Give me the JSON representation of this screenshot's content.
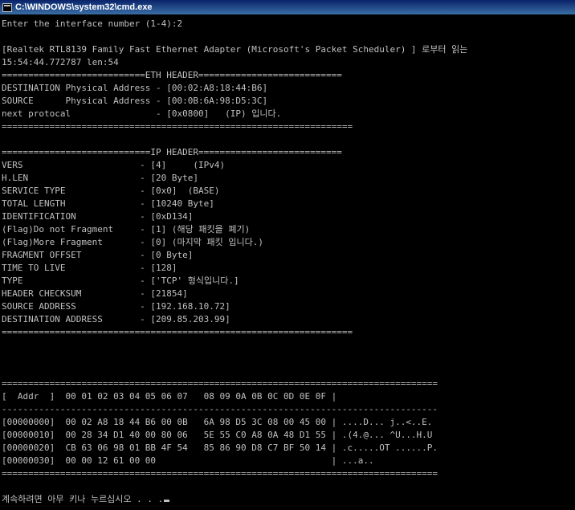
{
  "window": {
    "title": "C:\\WINDOWS\\system32\\cmd.exe"
  },
  "console": {
    "lines": [
      "Enter the interface number (1-4):2",
      "",
      "[Realtek RTL8139 Family Fast Ethernet Adapter (Microsoft's Packet Scheduler) ] 로부터 읽는",
      "15:54:44.772787 len:54",
      "===========================ETH HEADER===========================",
      "DESTINATION Physical Address - [00:02:A8:18:44:B6]",
      "SOURCE      Physical Address - [00:0B:6A:98:D5:3C]",
      "next protocal                - [0x0800]   (IP) 입니다.",
      "==================================================================",
      "",
      "============================IP HEADER===========================",
      "VERS                      - [4]     (IPv4)",
      "H.LEN                     - [20 Byte]",
      "SERVICE TYPE              - [0x0]  (BASE)",
      "TOTAL LENGTH              - [10240 Byte]",
      "IDENTIFICATION            - [0xD134]",
      "(Flag)Do not Fragment     - [1] (해당 패킷을 폐기)",
      "(Flag)More Fragment       - [0] (마지막 패킷 입니다.)",
      "FRAGMENT OFFSET           - [0 Byte]",
      "TIME TO LIVE              - [128]",
      "TYPE                      - ['TCP' 형식입니다.]",
      "HEADER CHECKSUM           - [21854]",
      "SOURCE ADDRESS            - [192.168.10.72]",
      "DESTINATION ADDRESS       - [209.85.203.99]",
      "==================================================================",
      "",
      "",
      "",
      "==================================================================================",
      "[  Addr  ]  00 01 02 03 04 05 06 07   08 09 0A 0B 0C 0D 0E 0F |",
      "----------------------------------------------------------------------------------",
      "[00000000]  00 02 A8 18 44 B6 00 0B   6A 98 D5 3C 08 00 45 00 | ....D... j..<..E.",
      "[00000010]  00 28 34 D1 40 00 80 06   5E 55 C0 A8 0A 48 D1 55 | .(4.@... ^U...H.U",
      "[00000020]  CB 63 06 98 01 BB 4F 54   85 86 90 D8 C7 BF 50 14 | .c.....OT ......P.",
      "[00000030]  00 00 12 61 00 00                                 | ...a..",
      "==================================================================================",
      "",
      "계속하려면 아무 키나 누르십시오 . . ."
    ]
  }
}
